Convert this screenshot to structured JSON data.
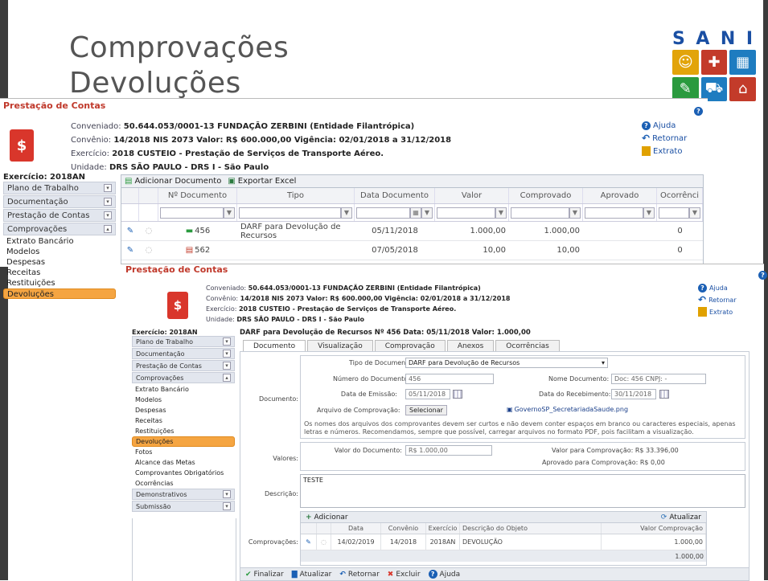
{
  "slide": {
    "title_line1": "Comprovações",
    "title_line2": "Devoluções",
    "logo_word": [
      "S",
      "A",
      "N",
      "I"
    ],
    "logo_colors": [
      "#e2a40a",
      "#c33b2a",
      "#1e7cc0",
      "#2a9a3e",
      "#1e7cc0",
      "#c33b2a"
    ]
  },
  "back": {
    "legend": "Prestação de Contas",
    "conveniado_label": "Conveniado:",
    "conveniado": "50.644.053/0001-13 FUNDAÇÃO ZERBINI (Entidade Filantrópica)",
    "convenio_label": "Convênio:",
    "convenio": "14/2018 NIS 2073 Valor: R$ 600.000,00 Vigência: 02/01/2018 a 31/12/2018",
    "exercicio_label": "Exercício:",
    "exercicio": "2018 CUSTEIO - Prestação de Serviços de Transporte Aéreo.",
    "unidade_label": "Unidade:",
    "unidade": "DRS SÃO PAULO - DRS I - São Paulo",
    "links": {
      "ajuda": "Ajuda",
      "retornar": "Retornar",
      "extrato": "Extrato"
    },
    "menu_head": "Exercício: 2018AN",
    "menu_groups": [
      "Plano de Trabalho",
      "Documentação",
      "Prestação de Contas",
      "Comprovações"
    ],
    "menu_links": [
      "Extrato Bancário",
      "Modelos",
      "Despesas",
      "Receitas",
      "Restituições",
      "Devoluções"
    ],
    "toolbar": {
      "add": "Adicionar Documento",
      "export": "Exportar Excel"
    },
    "columns": [
      "Nº Documento",
      "Tipo",
      "Data Documento",
      "Valor",
      "Comprovado",
      "Aprovado",
      "Ocorrênci"
    ],
    "rows": [
      {
        "num": "456",
        "tipo": "DARF para Devolução de Recursos",
        "data": "05/11/2018",
        "valor": "1.000,00",
        "comprovado": "1.000,00",
        "aprovado": "",
        "ocorr": "0"
      },
      {
        "num": "562",
        "tipo": "",
        "data": "07/05/2018",
        "valor": "10,00",
        "comprovado": "10,00",
        "aprovado": "",
        "ocorr": "0"
      }
    ]
  },
  "front": {
    "legend": "Prestação de Contas",
    "conveniado_label": "Conveniado:",
    "conveniado": "50.644.053/0001-13 FUNDAÇÃO ZERBINI (Entidade Filantrópica)",
    "convenio_label": "Convênio:",
    "convenio": "14/2018 NIS 2073 Valor: R$ 600.000,00 Vigência: 02/01/2018 a 31/12/2018",
    "exercicio_label": "Exercício:",
    "exercicio": "2018 CUSTEIO - Prestação de Serviços de Transporte Aéreo.",
    "unidade_label": "Unidade:",
    "unidade": "DRS SÃO PAULO - DRS I - São Paulo",
    "links": {
      "ajuda": "Ajuda",
      "retornar": "Retornar",
      "extrato": "Extrato"
    },
    "menu_head": "Exercício: 2018AN",
    "menu_groups_top": [
      "Plano de Trabalho",
      "Documentação",
      "Prestação de Contas",
      "Comprovações"
    ],
    "menu_links": [
      "Extrato Bancário",
      "Modelos",
      "Despesas",
      "Receitas",
      "Restituições",
      "Devoluções",
      "Fotos",
      "Alcance das Metas",
      "Comprovantes Obrigatórios",
      "Ocorrências"
    ],
    "menu_groups_bottom": [
      "Demonstrativos",
      "Submissão"
    ],
    "doc_header": "DARF para Devolução de Recursos Nº 456 Data: 05/11/2018 Valor: 1.000,00",
    "tabs": [
      "Documento",
      "Visualização",
      "Comprovação",
      "Anexos",
      "Ocorrências"
    ],
    "section_documento": "Documento:",
    "tipo_label": "Tipo de Documento:",
    "tipo_value": "DARF para Devolução de Recursos",
    "numero_label": "Número do Documento:",
    "numero_value": "456",
    "nome_label": "Nome Documento:",
    "nome_value": "Doc: 456 CNPJ: -",
    "emissao_label": "Data de Emissão:",
    "emissao_value": "05/11/2018",
    "recebimento_label": "Data do Recebimento:",
    "recebimento_value": "30/11/2018",
    "arquivo_label": "Arquivo de Comprovação:",
    "selecionar": "Selecionar",
    "arquivo_nome": "GovernoSP_SecretariadaSaude.png",
    "note": "Os nomes dos arquivos dos comprovantes devem ser curtos e não devem conter espaços em branco ou caracteres especiais, apenas letras e números. Recomendamos, sempre que possível, carregar arquivos no formato PDF, pois facilitam a visualização.",
    "section_valores": "Valores:",
    "valor_doc_label": "Valor do Documento:",
    "valor_doc_value": "R$ 1.000,00",
    "valor_comprov_label": "Valor para Comprovação:",
    "valor_comprov_value": "R$ 33.396,00",
    "aprovado_label": "Aprovado para Comprovação:",
    "aprovado_value": "R$ 0,00",
    "section_descricao": "Descrição:",
    "descricao_value": "TESTE",
    "section_comprovacoes": "Comprovações:",
    "adicionar": "Adicionar",
    "atualizar": "Atualizar",
    "comp_columns": [
      "Data",
      "Convênio",
      "Exercício",
      "Descrição do Objeto",
      "Valor Comprovação"
    ],
    "comp_row": {
      "data": "14/02/2019",
      "convenio": "14/2018",
      "exercicio": "2018AN",
      "descricao": "DEVOLUÇÃO",
      "valor": "1.000,00"
    },
    "comp_total": "1.000,00",
    "footer": {
      "finalizar": "Finalizar",
      "atualizar": "Atualizar",
      "retornar": "Retornar",
      "excluir": "Excluir",
      "ajuda": "Ajuda"
    }
  }
}
